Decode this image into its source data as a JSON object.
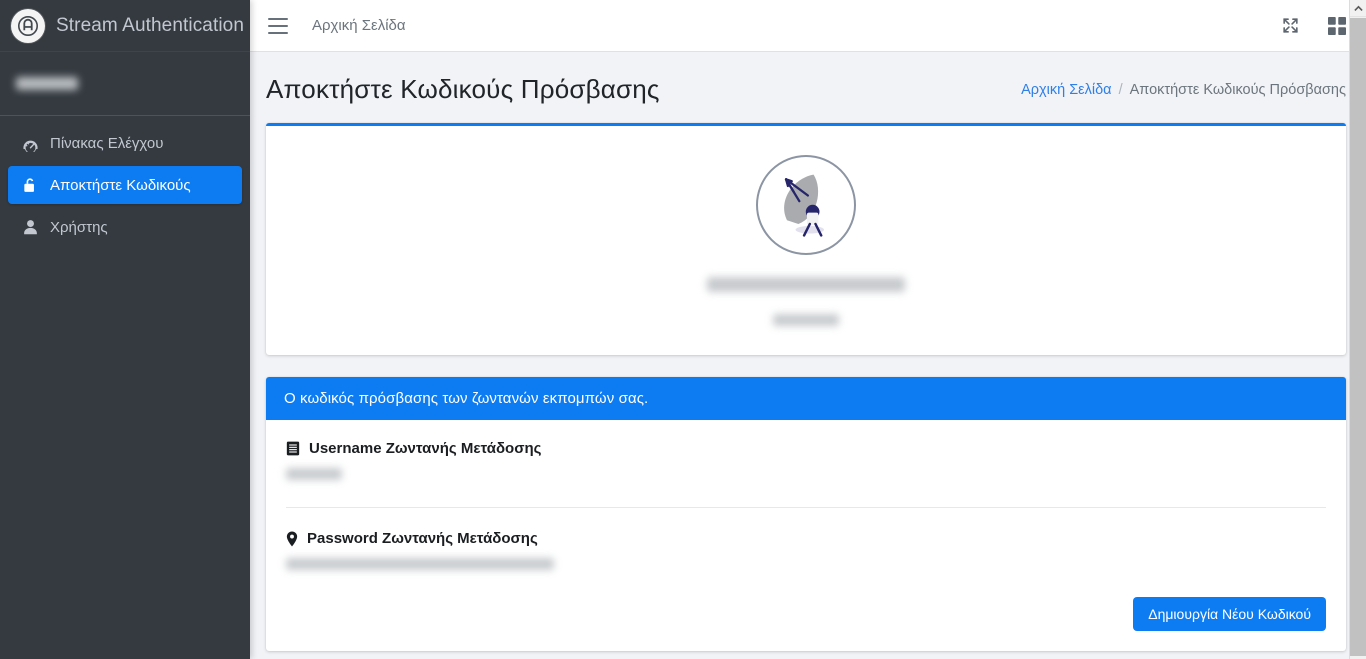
{
  "sidebar": {
    "brand_title": "Stream Authentication",
    "brand_logo_icon": "circle-a-logo-icon",
    "user_name_redacted": "",
    "items": [
      {
        "label": "Πίνακας Ελέγχου",
        "icon": "tachometer-icon",
        "active": false
      },
      {
        "label": "Αποκτήστε Κωδικούς",
        "icon": "unlock-icon",
        "active": true
      },
      {
        "label": "Χρήστης",
        "icon": "user-icon",
        "active": false
      }
    ]
  },
  "topbar": {
    "menu_icon": "hamburger-icon",
    "home_link": "Αρχική Σελίδα",
    "expand_icon": "expand-arrows-icon",
    "grid_icon": "grid-squares-icon"
  },
  "page": {
    "title": "Αποκτήστε Κωδικούς Πρόσβασης",
    "breadcrumb": {
      "home": "Αρχική Σελίδα",
      "separator": "/",
      "current": "Αποκτήστε Κωδικούς Πρόσβασης"
    }
  },
  "logo_card": {
    "dish_icon": "satellite-dish-icon",
    "station_name_redacted": "",
    "station_sub_redacted": ""
  },
  "info_card": {
    "banner": "Ο κωδικός πρόσβασης των ζωντανών εκπομπών σας.",
    "credentials": [
      {
        "icon": "book-icon",
        "label": "Username Ζωντανής Μετάδοσης",
        "value_redacted": ""
      },
      {
        "icon": "map-pin-icon",
        "label": "Password Ζωντανής Μετάδοσης",
        "value_redacted": ""
      }
    ],
    "action_button": "Δημιουργία Νέου Κωδικού"
  },
  "scrollbar": {
    "up_arrow_icon": "chevron-up-icon"
  },
  "colors": {
    "accent": "#0d7cf2",
    "sidebar_bg": "#343a40",
    "page_bg": "#f1f3f7",
    "sidebar_text": "#c2c7d0",
    "title_text": "#212529",
    "muted_text": "#6c757d",
    "link": "#2f7fe8",
    "dish_gray": "#a9abae",
    "dish_navy": "#26246a"
  }
}
